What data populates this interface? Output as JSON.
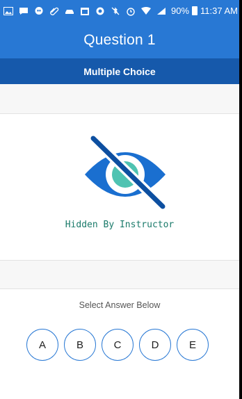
{
  "status_bar": {
    "battery": "90%",
    "time": "11:37 AM"
  },
  "header": {
    "title": "Question 1",
    "question_type": "Multiple Choice"
  },
  "content": {
    "hidden_icon": "eye-slash-icon",
    "hidden_label": "Hidden By Instructor"
  },
  "answers": {
    "prompt": "Select Answer Below",
    "options": [
      "A",
      "B",
      "C",
      "D",
      "E"
    ]
  },
  "colors": {
    "primary": "#2878d4",
    "primary_dark": "#1659ab",
    "eye": "#1a6fd0",
    "pupil": "#4fc3b2",
    "hidden_text": "#1a7a6a"
  }
}
